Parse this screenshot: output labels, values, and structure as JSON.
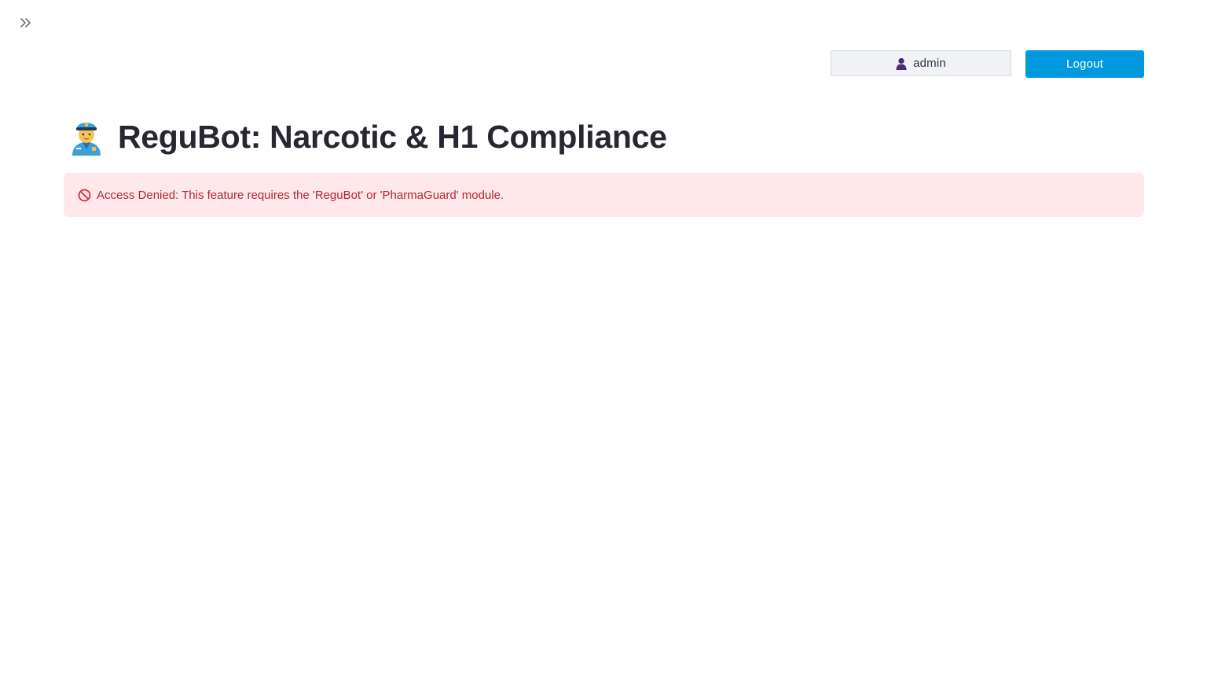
{
  "sidebar": {
    "toggle_icon": "double-chevron-right-icon"
  },
  "header": {
    "user_icon": "person-icon",
    "username": "admin",
    "logout_label": "Logout",
    "logout_color": "#0099dd"
  },
  "main": {
    "title_icon": "police-officer-icon",
    "title": "ReguBot: Narcotic & H1 Compliance",
    "alert": {
      "icon": "no-entry-icon",
      "message": "Access Denied: This feature requires the 'ReguBot' or 'PharmaGuard' module.",
      "background_color": "#ffe8ea",
      "text_color": "#b0263a"
    }
  }
}
